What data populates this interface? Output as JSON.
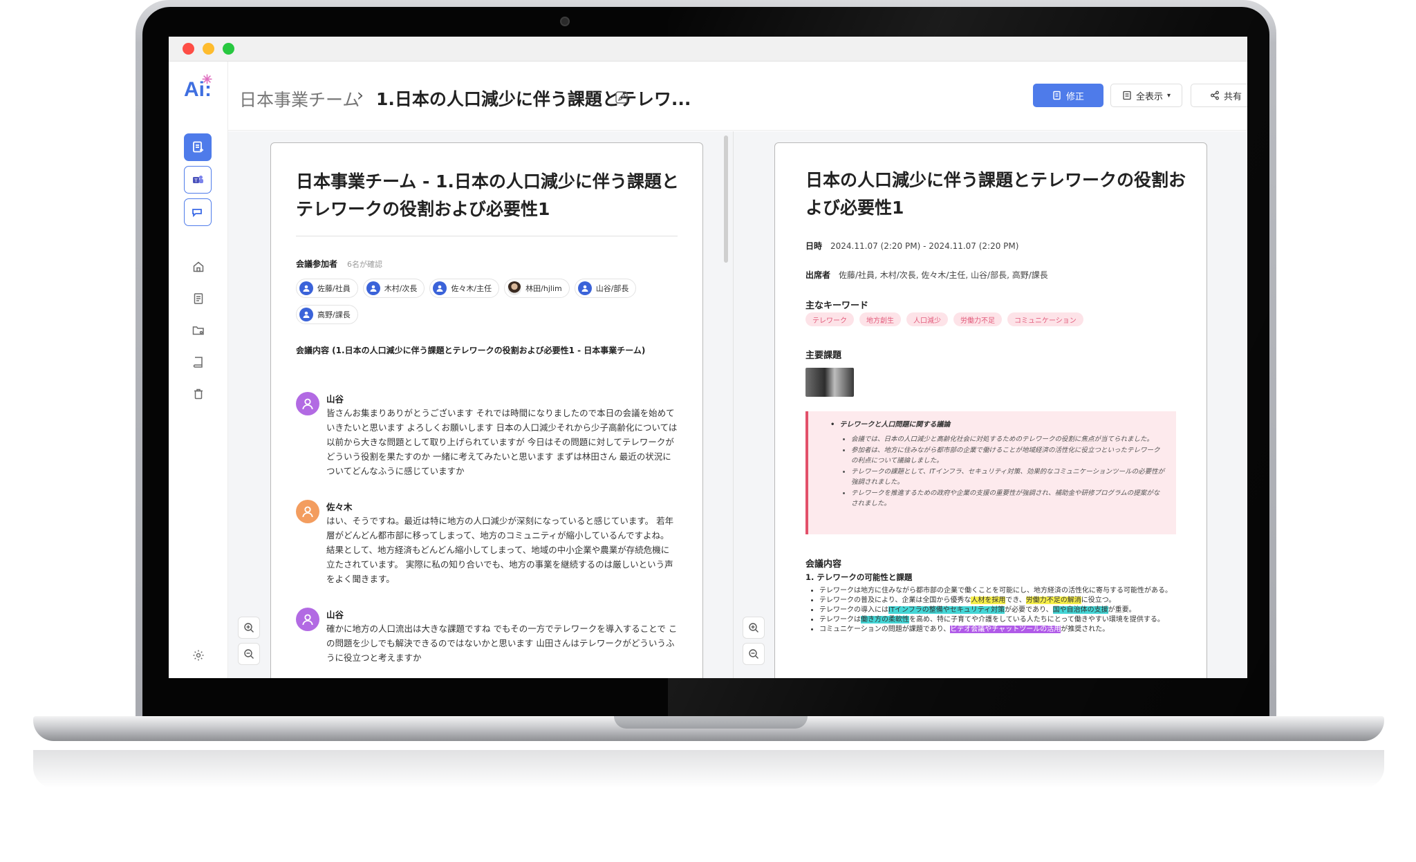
{
  "window": {
    "dots": [
      "close",
      "minimize",
      "maximize"
    ]
  },
  "sidebar": {
    "logo_text": "Ai:",
    "logo_spark": "✳",
    "quick_buttons": [
      {
        "name": "new-note-button",
        "icon": "note-plus-icon"
      },
      {
        "name": "teams-button",
        "icon": "teams-icon"
      },
      {
        "name": "meeting-button",
        "icon": "chat-bubble-icon"
      }
    ],
    "nav": [
      {
        "name": "home",
        "icon": "home-icon"
      },
      {
        "name": "documents",
        "icon": "document-icon"
      },
      {
        "name": "shared-folder",
        "icon": "folder-share-icon"
      },
      {
        "name": "book",
        "icon": "book-icon"
      },
      {
        "name": "trash",
        "icon": "trash-icon"
      }
    ],
    "settings_icon": "gear-icon"
  },
  "header": {
    "breadcrumb_parent": "日本事業チーム",
    "breadcrumb_separator": "›",
    "breadcrumb_current": "1.日本の人口減少に伴う課題とテレワ...",
    "edit_label": "修正",
    "view_label": "全表示",
    "view_caret": "▾",
    "share_label": "共有",
    "more_icon": "⋮"
  },
  "left_doc": {
    "title": "日本事業チーム - 1.日本の人口減少に伴う課題とテレワークの役割および必要性1",
    "attendees_label": "会議参加者",
    "attendees_count": "6名が確認",
    "attendees": [
      "佐藤/社員",
      "木村/次長",
      "佐々木/主任",
      "林田/hjlim",
      "山谷/部長",
      "高野/課長"
    ],
    "meeting_content_title": "会議内容 (1.日本の人口減少に伴う課題とテレワークの役割および必要性1 - 日本事業チーム)",
    "messages": [
      {
        "speaker": "山谷",
        "color": "#b26ae3",
        "text": "皆さんお集まりありがとうございます それでは時間になりましたので本日の会議を始めていきたいと思います よろしくお願いします 日本の人口減少それから少子高齢化については以前から大きな問題として取り上げられていますが 今日はその問題に対してテレワークがどういう役割を果たすのか 一緒に考えてみたいと思います まずは林田さん 最近の状況についてどんなふうに感じていますか"
      },
      {
        "speaker": "佐々木",
        "color": "#f39d5f",
        "text": "はい、そうですね。最近は特に地方の人口減少が深刻になっていると感じています。 若年層がどんどん都市部に移ってしまって、地方のコミュニティが縮小しているんですよね。 結果として、地方経済もどんどん縮小してしまって、地域の中小企業や農業が存続危機に立たされています。 実際に私の知り合いでも、地方の事業を継続するのは厳しいという声をよく聞きます。"
      },
      {
        "speaker": "山谷",
        "color": "#b26ae3",
        "text": "確かに地方の人口流出は大きな課題ですね でもその一方でテレワークを導入することで この問題を少しでも解決できるのではないかと思います 山田さんはテレワークがどういうふうに役立つと考えますか"
      }
    ]
  },
  "right_doc": {
    "title": "日本の人口減少に伴う課題とテレワークの役割および必要性1",
    "date_label": "日時",
    "date_value": "2024.11.07 (2:20 PM) - 2024.11.07 (2:20 PM)",
    "attendees_label": "出席者",
    "attendees_value": "佐藤/社員, 木村/次長, 佐々木/主任, 山谷/部長, 高野/課長",
    "keywords_label": "主なキーワード",
    "keywords": [
      "テレワーク",
      "地方創生",
      "人口減少",
      "労働力不足",
      "コミュニケーション"
    ],
    "issues_label": "主要課題",
    "callout_title": "テレワークと人口問題に関する議論",
    "callout_items": [
      "会議では、日本の人口減少と高齢化社会に対処するためのテレワークの役割に焦点が当てられました。",
      "参加者は、地方に住みながら都市部の企業で働けることが地域経済の活性化に役立つといったテレワークの利点について議論しました。",
      "テレワークの課題として、ITインフラ、セキュリティ対策、効果的なコミュニケーションツールの必要性が強調されました。",
      "テレワークを推進するための政府や企業の支援の重要性が強調され、補助金や研修プログラムの提案がなされました。"
    ],
    "content_label": "会議内容",
    "section_title": "1. テレワークの可能性と課題",
    "bullets": [
      {
        "pre": "テレワークは地方に住みながら都市部の企業で働くことを可能にし、地方経済の活性化に寄与する可能性がある。"
      },
      {
        "pre": "テレワークの普及により、企業は全国から優秀な",
        "h1": "人材を採用",
        "mid": "でき、",
        "h2": "労働力不足の解消",
        "post": "に役立つ。",
        "c1": "y",
        "c2": "y"
      },
      {
        "pre": "テレワークの導入には",
        "h1": "ITインフラの整備やセキュリティ対策",
        "mid": "が必要であり、",
        "h2": "国や自治体の支援",
        "post": "が重要。",
        "c1": "c",
        "c2": "c"
      },
      {
        "pre": "テレワークは",
        "h1": "働き方の柔軟性",
        "mid": "を高め、特に子育てや介護をしている人たちにとって働きやすい環境を提供する。",
        "c1": "c"
      },
      {
        "pre": "コミュニケーションの問題が課題であり、",
        "h1": "ビデオ会議やチャットツールの活用",
        "mid": "が推奨された。",
        "c1": "p"
      }
    ]
  },
  "zoom": {
    "in": "+",
    "out": "−"
  }
}
